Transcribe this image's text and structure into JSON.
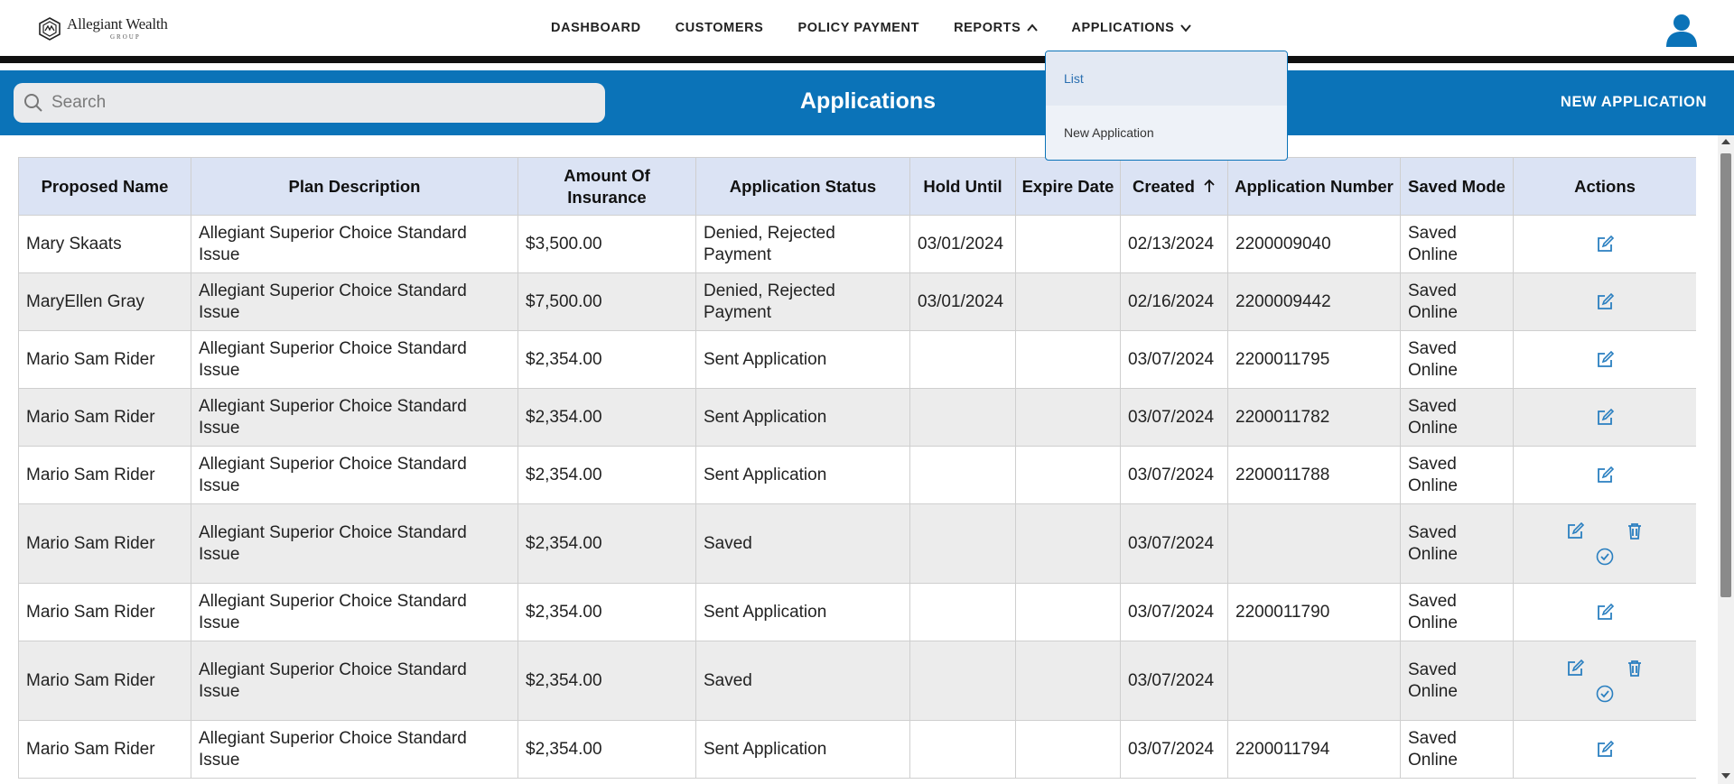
{
  "brand": {
    "name": "Allegiant Wealth",
    "sub": "GROUP"
  },
  "nav": {
    "dashboard": "DASHBOARD",
    "customers": "CUSTOMERS",
    "policy_payment": "POLICY PAYMENT",
    "reports": "REPORTS",
    "applications": "APPLICATIONS"
  },
  "dropdown": {
    "list": "List",
    "new_application": "New Application"
  },
  "header": {
    "search_placeholder": "Search",
    "title": "Applications",
    "new_application": "NEW APPLICATION"
  },
  "colors": {
    "accent": "#0b73b8",
    "table_header": "#dbe3f4",
    "icon_blue": "#2a7fc0"
  },
  "table": {
    "columns": {
      "proposed_name": "Proposed Name",
      "plan_description": "Plan Description",
      "amount": "Amount Of Insurance",
      "status": "Application Status",
      "hold_until": "Hold Until",
      "expire_date": "Expire Date",
      "created": "Created",
      "app_number": "Application Number",
      "saved_mode": "Saved Mode",
      "actions": "Actions"
    },
    "rows": [
      {
        "name": "Mary Skaats",
        "plan": "Allegiant Superior Choice Standard Issue",
        "amount": "$3,500.00",
        "status": "Denied, Rejected Payment",
        "hold": "03/01/2024",
        "expire": "",
        "created": "02/13/2024",
        "number": "2200009040",
        "mode": "Saved Online"
      },
      {
        "name": "MaryEllen Gray",
        "plan": "Allegiant Superior Choice Standard Issue",
        "amount": "$7,500.00",
        "status": "Denied, Rejected Payment",
        "hold": "03/01/2024",
        "expire": "",
        "created": "02/16/2024",
        "number": "2200009442",
        "mode": "Saved Online"
      },
      {
        "name": "Mario Sam Rider",
        "plan": "Allegiant Superior Choice Standard Issue",
        "amount": "$2,354.00",
        "status": "Sent Application",
        "hold": "",
        "expire": "",
        "created": "03/07/2024",
        "number": "2200011795",
        "mode": "Saved Online"
      },
      {
        "name": "Mario Sam Rider",
        "plan": "Allegiant Superior Choice Standard Issue",
        "amount": "$2,354.00",
        "status": "Sent Application",
        "hold": "",
        "expire": "",
        "created": "03/07/2024",
        "number": "2200011782",
        "mode": "Saved Online"
      },
      {
        "name": "Mario Sam Rider",
        "plan": "Allegiant Superior Choice Standard Issue",
        "amount": "$2,354.00",
        "status": "Sent Application",
        "hold": "",
        "expire": "",
        "created": "03/07/2024",
        "number": "2200011788",
        "mode": "Saved Online"
      },
      {
        "name": "Mario Sam Rider",
        "plan": "Allegiant Superior Choice Standard Issue",
        "amount": "$2,354.00",
        "status": "Saved",
        "hold": "",
        "expire": "",
        "created": "03/07/2024",
        "number": "",
        "mode": "Saved Online"
      },
      {
        "name": "Mario Sam Rider",
        "plan": "Allegiant Superior Choice Standard Issue",
        "amount": "$2,354.00",
        "status": "Sent Application",
        "hold": "",
        "expire": "",
        "created": "03/07/2024",
        "number": "2200011790",
        "mode": "Saved Online"
      },
      {
        "name": "Mario Sam Rider",
        "plan": "Allegiant Superior Choice Standard Issue",
        "amount": "$2,354.00",
        "status": "Saved",
        "hold": "",
        "expire": "",
        "created": "03/07/2024",
        "number": "",
        "mode": "Saved Online"
      },
      {
        "name": "Mario Sam Rider",
        "plan": "Allegiant Superior Choice Standard Issue",
        "amount": "$2,354.00",
        "status": "Sent Application",
        "hold": "",
        "expire": "",
        "created": "03/07/2024",
        "number": "2200011794",
        "mode": "Saved Online"
      }
    ]
  }
}
